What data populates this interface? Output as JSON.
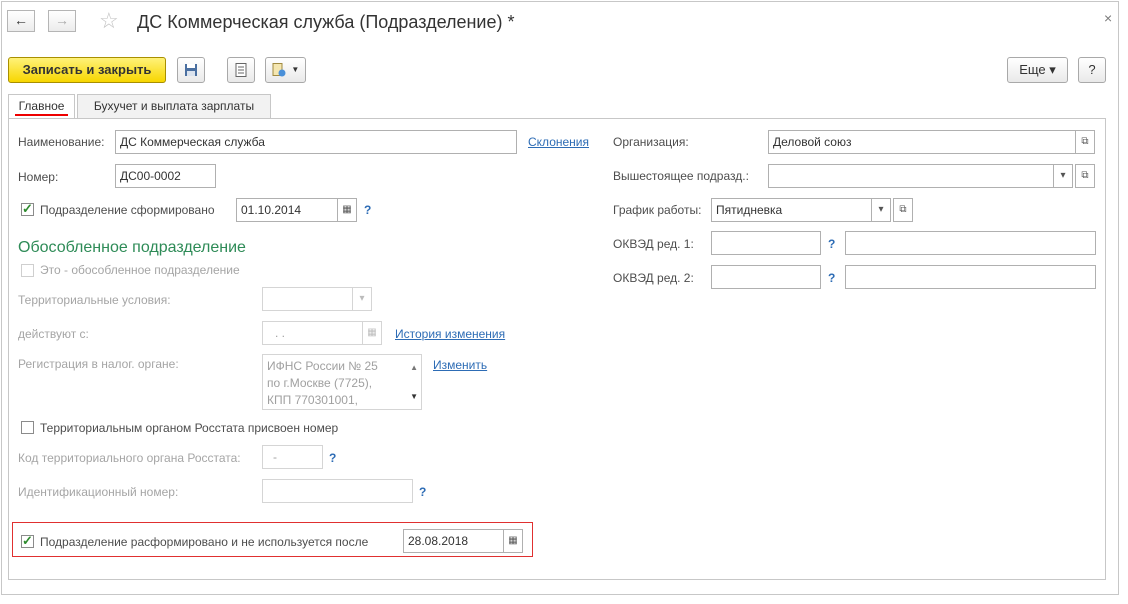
{
  "window": {
    "title": "ДС Коммерческая служба (Подразделение) *",
    "back_icon": "←",
    "forward_icon": "→",
    "favorite_icon": "☆",
    "close_icon": "×"
  },
  "toolbar": {
    "save_close_label": "Записать и закрыть",
    "more_label": "Еще ▾",
    "help_label": "?"
  },
  "tabs": [
    {
      "label": "Главное",
      "active": true
    },
    {
      "label": "Бухучет и выплата зарплаты",
      "active": false
    }
  ],
  "left": {
    "name_label": "Наименование:",
    "name_value": "ДС Коммерческая служба",
    "declension_link": "Склонения",
    "number_label": "Номер:",
    "number_value": "ДС00-0002",
    "formed_label": "Подразделение сформировано",
    "formed_checked": true,
    "formed_date": "01.10.2014",
    "help_mark": "?",
    "section_title": "Обособленное подразделение",
    "separate_label": "Это - обособленное подразделение",
    "territorial_label": "Территориальные условия:",
    "effective_label": "действуют с:",
    "effective_value": ". .",
    "history_link": "История изменения",
    "tax_label": "Регистрация в налог. органе:",
    "tax_lines": [
      "ИФНС России № 25",
      "по г.Москве (7725),",
      "КПП 770301001,"
    ],
    "change_link": "Изменить",
    "rosstat_check_label": "Территориальным органом Росстата присвоен номер",
    "rosstat_code_label": "Код территориального органа Росстата:",
    "rosstat_code_value": "-",
    "ident_label": "Идентификационный номер:",
    "disbanded_label": "Подразделение расформировано и не используется после",
    "disbanded_checked": true,
    "disbanded_date": "28.08.2018"
  },
  "right": {
    "org_label": "Организация:",
    "org_value": "Деловой союз",
    "parent_label": "Вышестоящее подразд.:",
    "parent_value": "",
    "schedule_label": "График работы:",
    "schedule_value": "Пятидневка",
    "okved1_label": "ОКВЭД ред. 1:",
    "okved2_label": "ОКВЭД ред. 2:"
  },
  "colors": {
    "primary_button": "#f7d600",
    "link": "#2d6cb5",
    "section": "#2e8b57",
    "highlight_box": "#e03030"
  }
}
